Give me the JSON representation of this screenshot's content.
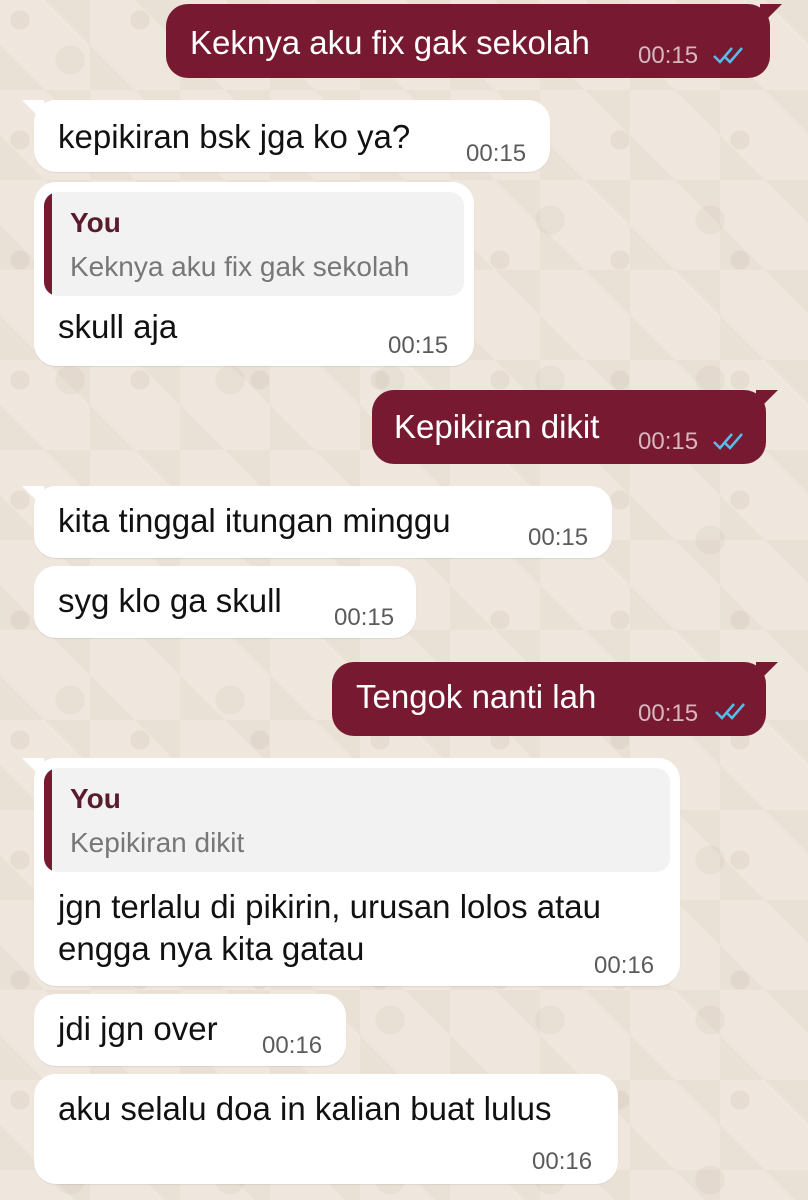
{
  "conversation": {
    "messages": [
      {
        "direction": "out",
        "text": "Keknya aku fix gak sekolah",
        "time": "00:15",
        "status": "read"
      },
      {
        "direction": "in",
        "text": "kepikiran bsk jga ko ya?",
        "time": "00:15"
      },
      {
        "direction": "in",
        "reply_to": {
          "author": "You",
          "text": "Keknya aku fix gak sekolah"
        },
        "text": "skull aja",
        "time": "00:15"
      },
      {
        "direction": "out",
        "text": "Kepikiran dikit",
        "time": "00:15",
        "status": "read"
      },
      {
        "direction": "in",
        "text": "kita tinggal itungan minggu",
        "time": "00:15"
      },
      {
        "direction": "in",
        "text": "syg klo ga skull",
        "time": "00:15"
      },
      {
        "direction": "out",
        "text": "Tengok nanti lah",
        "time": "00:15",
        "status": "read"
      },
      {
        "direction": "in",
        "reply_to": {
          "author": "You",
          "text": "Kepikiran dikit"
        },
        "text_lines": [
          "jgn terlalu di pikirin, urusan lolos atau",
          "engga nya kita gatau"
        ],
        "time": "00:16"
      },
      {
        "direction": "in",
        "text": "jdi jgn over",
        "time": "00:16"
      },
      {
        "direction": "in",
        "text": "aku selalu doa in kalian buat lulus",
        "time": "00:16"
      }
    ]
  },
  "theme": {
    "outgoing_bubble": "#771a31",
    "incoming_bubble": "#ffffff",
    "wallpaper": "#efe7dd",
    "read_ticks": "#53bdeb"
  }
}
